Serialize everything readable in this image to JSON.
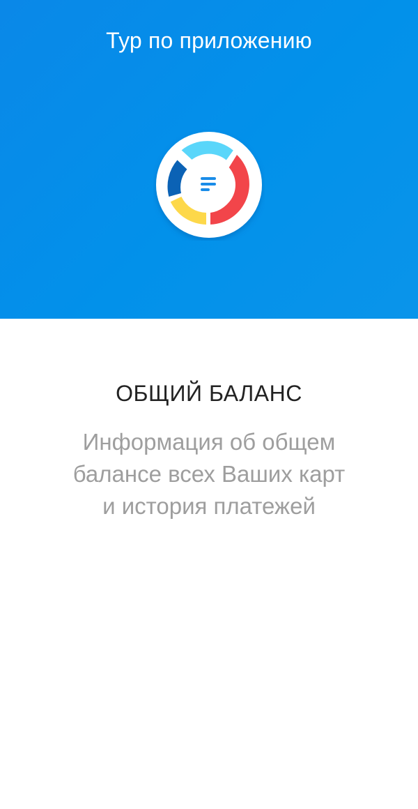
{
  "header": {
    "title": "Тур по приложению"
  },
  "hero": {
    "background_color": "#0291ea",
    "logo_icon": "balance-donut-icon",
    "logo_colors": {
      "ring": "#ffffff",
      "light_blue": "#5ad6fa",
      "red": "#f2454a",
      "yellow": "#fdd84a",
      "dark_blue": "#0b62b5",
      "center_lines": "#1a8ce8"
    }
  },
  "slide": {
    "title": "ОБЩИЙ БАЛАНС",
    "description_lines": [
      "Информация об общем",
      "балансе всех Ваших карт",
      "и история платежей"
    ]
  }
}
